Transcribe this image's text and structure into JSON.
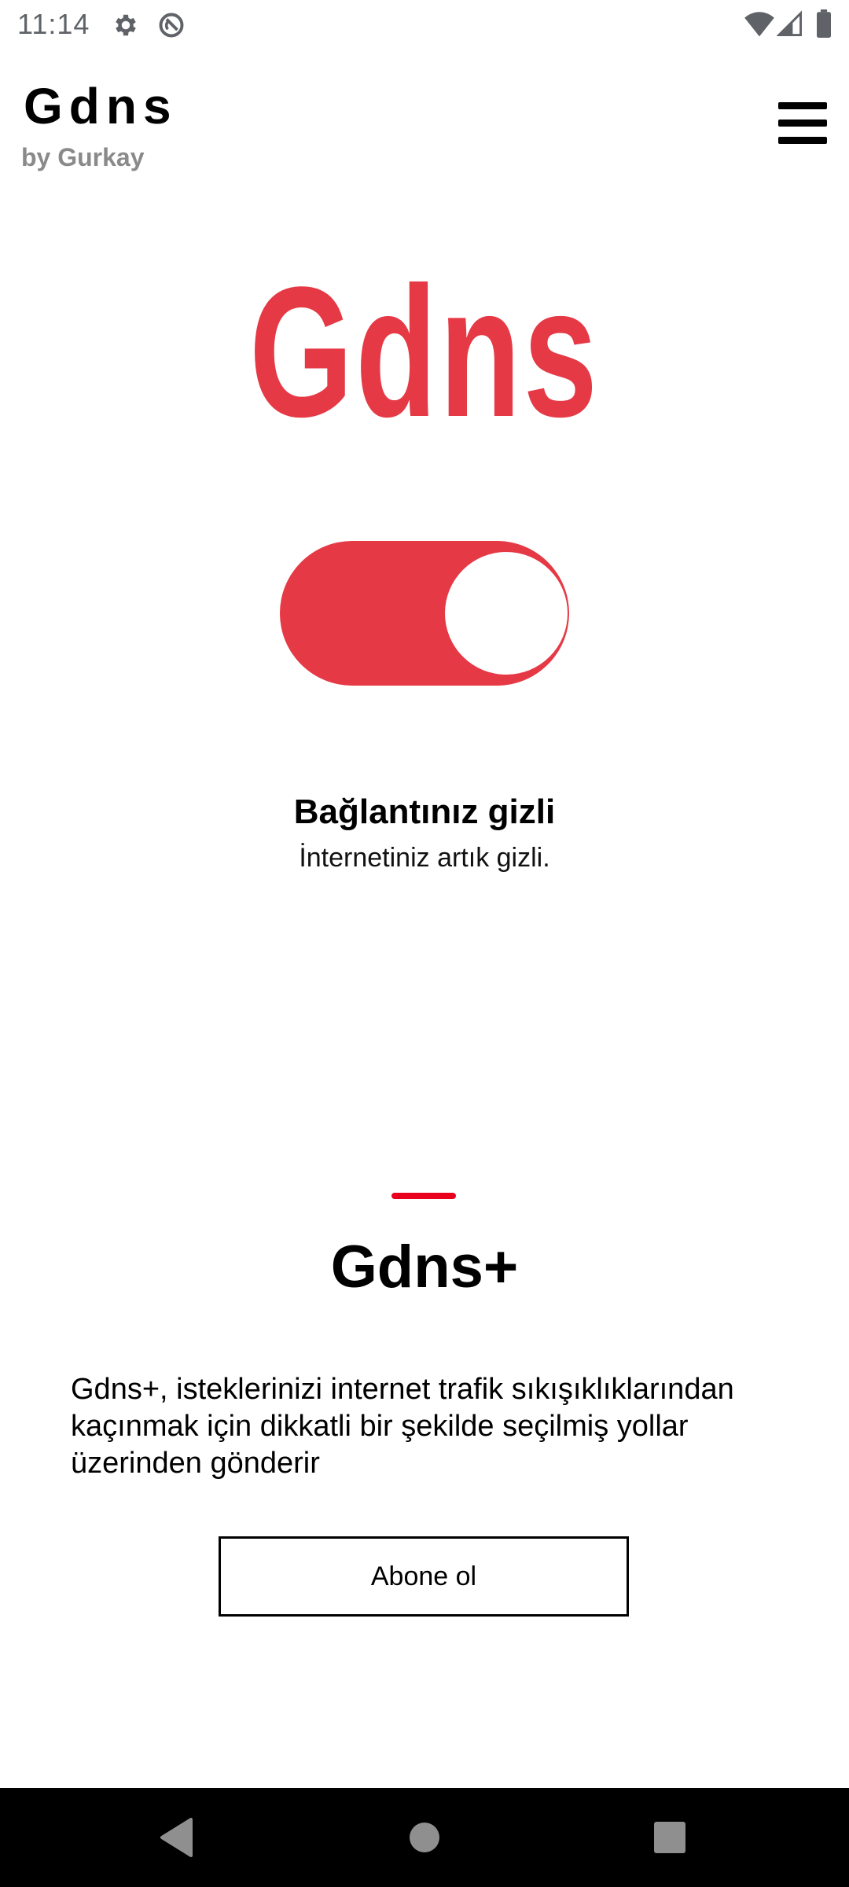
{
  "status_bar": {
    "time": "11:14",
    "left_icons": [
      "settings-icon",
      "data-saver-icon"
    ],
    "right_icons": [
      "wifi-icon",
      "signal-icon",
      "battery-icon"
    ]
  },
  "header": {
    "title": "Gdns",
    "subtitle": "by Gurkay",
    "menu_icon": "hamburger-menu-icon"
  },
  "hero": {
    "logo_text": "Gdns",
    "toggle_on": true
  },
  "connection": {
    "status": "Bağlantınız gizli",
    "detail": "İnternetiniz artık gizli."
  },
  "premium": {
    "title": "Gdns+",
    "description": "Gdns+, isteklerinizi internet trafik sıkışıklıklarından kaçınmak için dikkatli bir şekilde seçilmiş yollar üzerinden gönderir",
    "button_label": "Abone ol"
  },
  "nav_bar": {
    "buttons": [
      "back-icon",
      "home-icon",
      "recents-icon"
    ]
  },
  "colors": {
    "accent": "#e63946",
    "accent_line": "#e8001c",
    "subtitle_gray": "#8a8a8a",
    "nav_bar": "#000000"
  }
}
